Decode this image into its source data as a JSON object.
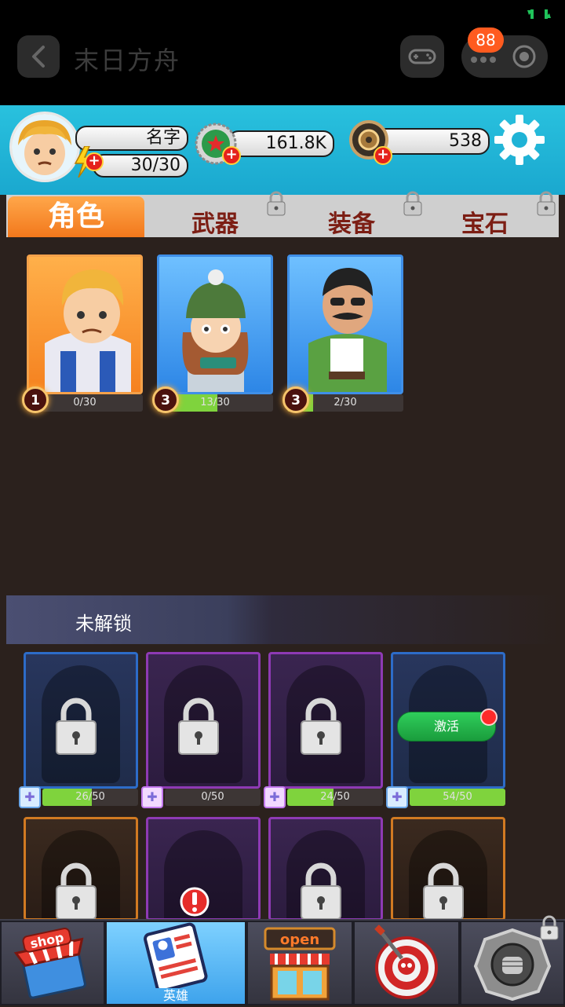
{
  "app": {
    "title": "末日方舟",
    "notification_count": "88"
  },
  "player": {
    "name": "名字",
    "energy": "30/30",
    "coins": "161.8K",
    "gems": "538"
  },
  "tabs": [
    {
      "label": "角色",
      "active": true,
      "locked": false
    },
    {
      "label": "武器",
      "active": false,
      "locked": true
    },
    {
      "label": "装备",
      "active": false,
      "locked": true
    },
    {
      "label": "宝石",
      "active": false,
      "locked": true
    }
  ],
  "unlocked_heroes": [
    {
      "level": "1",
      "progress": "0/30",
      "fill": 0.0,
      "frame": "orange"
    },
    {
      "level": "3",
      "progress": "13/30",
      "fill": 0.43,
      "frame": "blue"
    },
    {
      "level": "3",
      "progress": "2/30",
      "fill": 0.07,
      "frame": "blue"
    }
  ],
  "locked_section": {
    "title": "未解锁"
  },
  "locked_heroes": [
    {
      "progress": "26/50",
      "fill": 0.52,
      "frame": "blue"
    },
    {
      "progress": "0/50",
      "fill": 0.0,
      "frame": "purple"
    },
    {
      "progress": "24/50",
      "fill": 0.48,
      "frame": "purple"
    },
    {
      "progress": "54/50",
      "fill": 1.0,
      "frame": "blue",
      "action_label": "激活"
    },
    {
      "frame": "orange"
    },
    {
      "frame": "purple"
    },
    {
      "frame": "purple"
    },
    {
      "frame": "orange"
    }
  ],
  "bottom_nav": [
    {
      "label": "shop",
      "icon": "shop-icon"
    },
    {
      "label": "英雄",
      "icon": "hero-card-icon",
      "active": true
    },
    {
      "label": "open",
      "icon": "store-icon"
    },
    {
      "label": "",
      "icon": "skull-target-icon"
    },
    {
      "label": "",
      "icon": "fist-badge-icon",
      "locked": true
    }
  ],
  "colors": {
    "accent": "#f2781c",
    "progress": "#7fd33d",
    "header": "#1fb3d6"
  }
}
